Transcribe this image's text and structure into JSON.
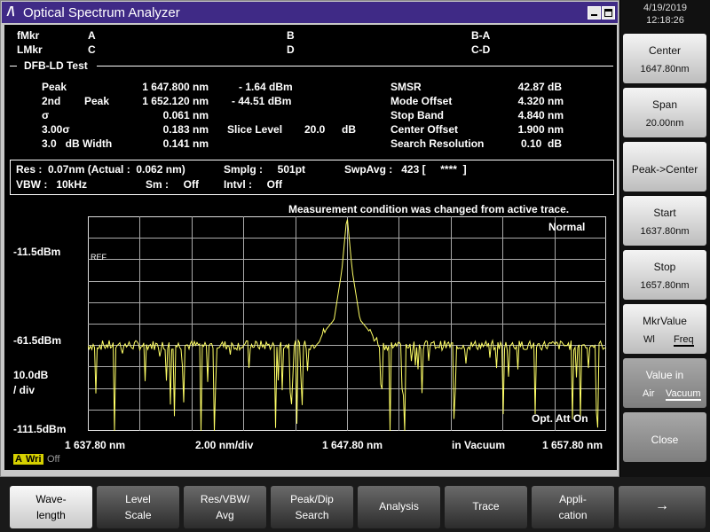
{
  "window": {
    "title": "Optical Spectrum Analyzer"
  },
  "markers": {
    "fmkr_label": "fMkr",
    "lmkr_label": "LMkr",
    "a": "A",
    "b": "B",
    "ba": "B-A",
    "c": "C",
    "d": "D",
    "cd": "C-D"
  },
  "test": {
    "section_title": "DFB-LD Test",
    "left_rows": [
      {
        "label": "Peak",
        "sublabel": "",
        "value": "1 647.800 nm",
        "extra": "- 1.64  dBm"
      },
      {
        "label": "2nd",
        "sublabel": "Peak",
        "value": "1 652.120 nm",
        "extra": "- 44.51  dBm"
      },
      {
        "label": "σ",
        "sublabel": "",
        "value": "0.061 nm",
        "extra": ""
      },
      {
        "label": "3.00σ",
        "sublabel": "",
        "value": "0.183 nm",
        "extra": ""
      },
      {
        "label": "3.0   dB Width",
        "sublabel": "",
        "value": "0.141 nm",
        "extra": ""
      }
    ],
    "slice_label": "Slice Level",
    "slice_value": "20.0",
    "slice_unit": "dB",
    "right_rows": [
      {
        "label": "SMSR",
        "value": "42.87 dB"
      },
      {
        "label": "Mode Offset",
        "value": "4.320 nm"
      },
      {
        "label": "Stop Band",
        "value": "4.840 nm"
      },
      {
        "label": "Center Offset",
        "value": "1.900 nm"
      },
      {
        "label": "Search Resolution",
        "value": "0.10  dB"
      }
    ]
  },
  "conditions": {
    "res": "Res :  0.07nm (Actual :  0.062 nm)",
    "smplg": "Smplg :     501pt",
    "swpavg": "SwpAvg :   423 [     ****  ]",
    "vbw": "VBW :   10kHz",
    "sm": "Sm :     Off",
    "intvl": "Intvl :     Off"
  },
  "message": "Measurement condition was changed from active trace.",
  "graph": {
    "mode": "Normal",
    "ref_label": "REF",
    "ref_level": "-11.5dBm",
    "mid_level": "-61.5dBm",
    "scale_1": "10.0dB",
    "scale_2": "/ div",
    "bottom_level": "-111.5dBm",
    "att": "Opt. Att On",
    "x_start": "1 637.80 nm",
    "x_div": "2.00 nm/div",
    "x_center": "1 647.80 nm",
    "x_medium": "in Vacuum",
    "x_stop": "1 657.80 nm",
    "status_a": "A",
    "status_wri": "Wri",
    "status_off": "Off",
    "accent_trace": "#ffff66"
  },
  "chart_data": {
    "type": "line",
    "title": "",
    "xlabel": "",
    "ylabel": "",
    "xlim": [
      1637.8,
      1657.8
    ],
    "ylim": [
      -111.5,
      -11.5
    ],
    "x": [
      1637.8,
      1642.0,
      1646.5,
      1647.3,
      1647.6,
      1647.8,
      1648.0,
      1648.3,
      1649.1,
      1653.0,
      1657.8
    ],
    "series": [
      {
        "values": [
          -68,
          -68,
          -68,
          -55,
          -30,
          -1.64,
          -30,
          -55,
          -68,
          -68,
          -68
        ]
      }
    ]
  },
  "side": {
    "date": "4/19/2019",
    "time": "12:18:26",
    "center_label": "Center",
    "center_value": "1647.80nm",
    "span_label": "Span",
    "span_value": "20.00nm",
    "peak_center": "Peak->Center",
    "start_label": "Start",
    "start_value": "1637.80nm",
    "stop_label": "Stop",
    "stop_value": "1657.80nm",
    "mkr_label": "MkrValue",
    "mkr_opt1": "Wl",
    "mkr_opt2": "Freq",
    "valuein_label": "Value in",
    "valuein_opt1": "Air",
    "valuein_opt2": "Vacuum",
    "close": "Close"
  },
  "bottom": {
    "wave_1": "Wave-",
    "wave_2": "length",
    "level_1": "Level",
    "level_2": "Scale",
    "res_1": "Res/VBW/",
    "res_2": "Avg",
    "peak_1": "Peak/Dip",
    "peak_2": "Search",
    "analysis": "Analysis",
    "trace": "Trace",
    "app_1": "Appli-",
    "app_2": "cation",
    "next": "→"
  }
}
